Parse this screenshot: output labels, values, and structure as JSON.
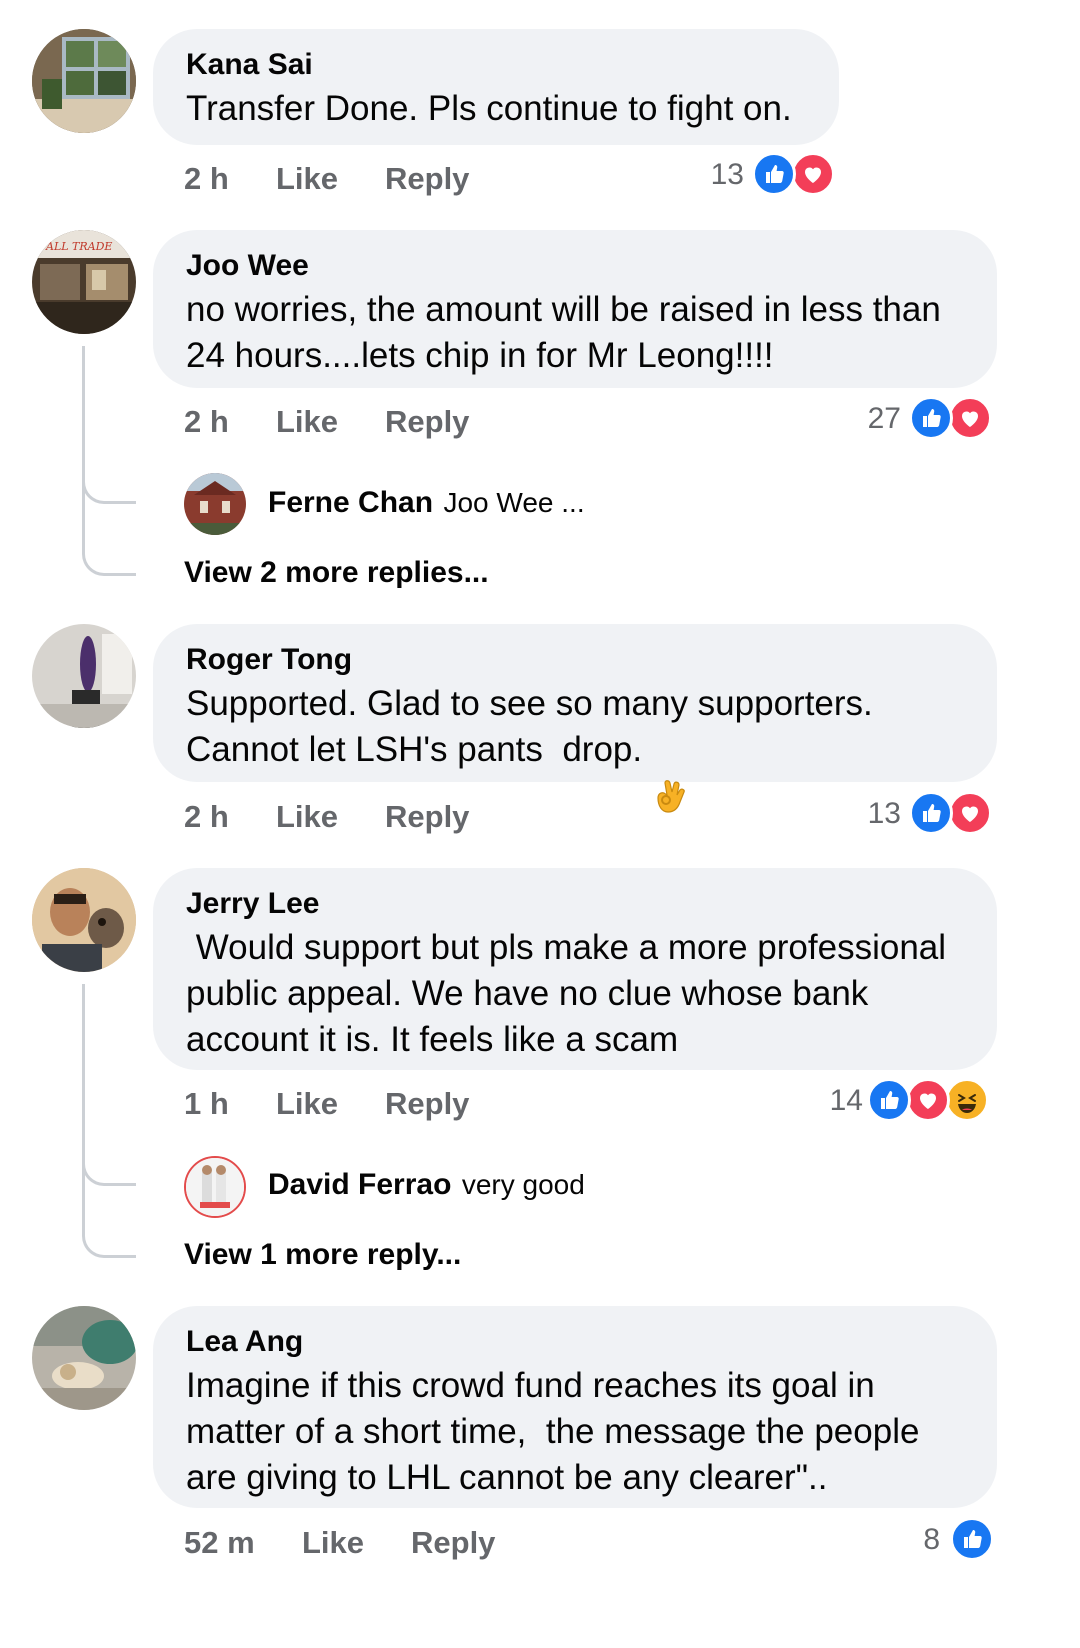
{
  "comments": [
    {
      "name": "Kana Sai",
      "lines": [
        "Transfer Done. Pls continue to fight on."
      ],
      "time": "2 h",
      "like_label": "Like",
      "reply_label": "Reply",
      "reaction_count": "13",
      "reactions": [
        "like-icon",
        "love-icon"
      ]
    },
    {
      "name": "Joo Wee",
      "lines": [
        "no worries, the amount will be raised in less than",
        "24 hours....lets chip in for Mr Leong!!!!"
      ],
      "time": "2 h",
      "like_label": "Like",
      "reply_label": "Reply",
      "reaction_count": "27",
      "reactions": [
        "like-icon",
        "love-icon"
      ],
      "reply_preview": {
        "name": "Ferne Chan",
        "text": "Joo Wee ..."
      },
      "more_replies": "View 2 more replies..."
    },
    {
      "name": "Roger Tong",
      "lines": [
        "Supported. Glad to see so many supporters.",
        "Cannot let LSH's pants  drop. "
      ],
      "emoji": "ok-hand-emoji",
      "time": "2 h",
      "like_label": "Like",
      "reply_label": "Reply",
      "reaction_count": "13",
      "reactions": [
        "like-icon",
        "love-icon"
      ]
    },
    {
      "name": "Jerry Lee",
      "lines": [
        " Would support but pls make a more professional",
        "public appeal. We have no clue whose bank",
        "account it is. It feels like a scam"
      ],
      "time": "1 h",
      "like_label": "Like",
      "reply_label": "Reply",
      "reaction_count": "14",
      "reactions": [
        "like-icon",
        "love-icon",
        "haha-icon"
      ],
      "reply_preview": {
        "name": "David Ferrao",
        "text": "very good"
      },
      "more_replies": "View 1 more reply..."
    },
    {
      "name": "Lea Ang",
      "lines": [
        "Imagine if this crowd fund reaches its goal in",
        "matter of a short time,  the message the people",
        "are giving to LHL cannot be any clearer\".."
      ],
      "time": "52 m",
      "like_label": "Like",
      "reply_label": "Reply",
      "reaction_count": "8",
      "reactions": [
        "like-icon"
      ]
    }
  ],
  "colors": {
    "bubble": "#f0f2f5",
    "meta": "#65676b",
    "like_blue": "#1877f2",
    "love_red": "#f33e58",
    "haha_yellow": "#f7b125"
  }
}
